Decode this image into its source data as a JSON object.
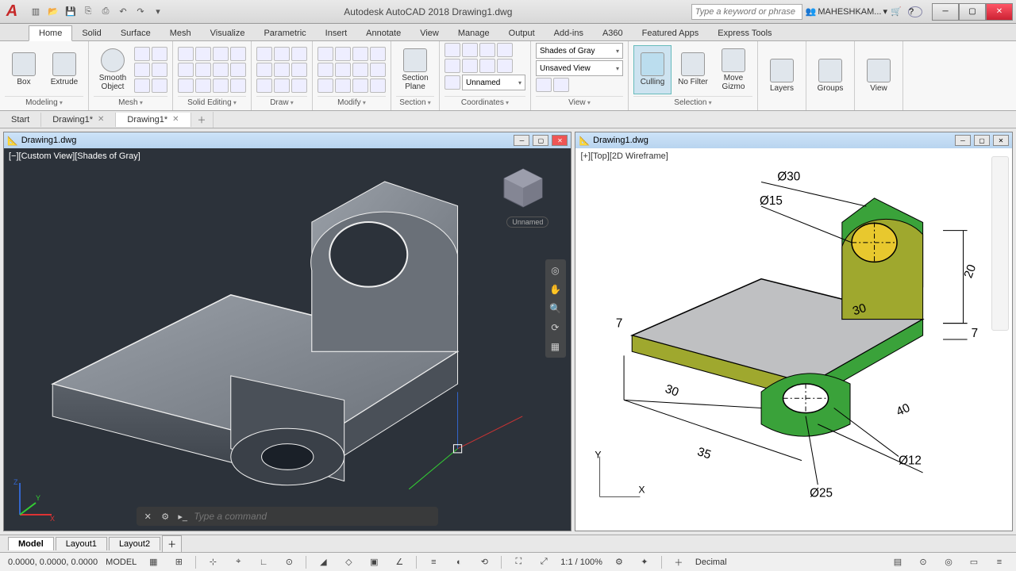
{
  "app": {
    "title": "Autodesk AutoCAD 2018   Drawing1.dwg",
    "logo": "A"
  },
  "qat": [
    "new",
    "open",
    "save",
    "saveas",
    "print",
    "undo",
    "redo"
  ],
  "search": {
    "placeholder": "Type a keyword or phrase"
  },
  "user": {
    "name": "MAHESHKAM..."
  },
  "ribbon_tabs": [
    "Home",
    "Solid",
    "Surface",
    "Mesh",
    "Visualize",
    "Parametric",
    "Insert",
    "Annotate",
    "View",
    "Manage",
    "Output",
    "Add-ins",
    "A360",
    "Featured Apps",
    "Express Tools"
  ],
  "ribbon_active": "Home",
  "panels": {
    "modeling": {
      "label": "Modeling",
      "box": "Box",
      "extrude": "Extrude"
    },
    "mesh": {
      "label": "Mesh",
      "smooth": "Smooth Object"
    },
    "solid_editing": {
      "label": "Solid Editing"
    },
    "draw": {
      "label": "Draw"
    },
    "modify": {
      "label": "Modify"
    },
    "section": {
      "label": "Section",
      "plane": "Section Plane"
    },
    "coordinates": {
      "label": "Coordinates",
      "unnamed": "Unnamed"
    },
    "view": {
      "label": "View",
      "style": "Shades of Gray",
      "saved": "Unsaved View"
    },
    "selection": {
      "label": "Selection",
      "culling": "Culling",
      "filter": "No Filter",
      "gizmo": "Move Gizmo"
    },
    "layers": {
      "label": "Layers",
      "btn": "Layers"
    },
    "groups": {
      "label": "Groups",
      "btn": "Groups"
    },
    "viewpanel": {
      "label": "View",
      "btn": "View"
    }
  },
  "file_tabs": [
    {
      "label": "Start",
      "active": false,
      "closable": false
    },
    {
      "label": "Drawing1*",
      "active": false,
      "closable": true
    },
    {
      "label": "Drawing1*",
      "active": true,
      "closable": true
    }
  ],
  "doc_left": {
    "title": "Drawing1.dwg",
    "vp_label": "[−][Custom View][Shades of Gray]",
    "viewcube_home": "Unnamed"
  },
  "doc_right": {
    "title": "Drawing1.dwg",
    "vp_label": "[+][Top][2D Wireframe]",
    "dims": {
      "d30a": "Ø30",
      "d15": "Ø15",
      "d12": "Ø12",
      "d25": "Ø25",
      "h30": "30",
      "w30": "30",
      "w35": "35",
      "w40": "40",
      "h20": "20",
      "t7a": "7",
      "t7b": "7"
    },
    "axes": {
      "x": "X",
      "y": "Y"
    }
  },
  "cmd": {
    "placeholder": "Type a command"
  },
  "layout_tabs": [
    "Model",
    "Layout1",
    "Layout2"
  ],
  "layout_active": "Model",
  "status": {
    "coords": "0.0000, 0.0000, 0.0000",
    "space": "MODEL",
    "scale": "1:1 / 100%",
    "units": "Decimal"
  }
}
